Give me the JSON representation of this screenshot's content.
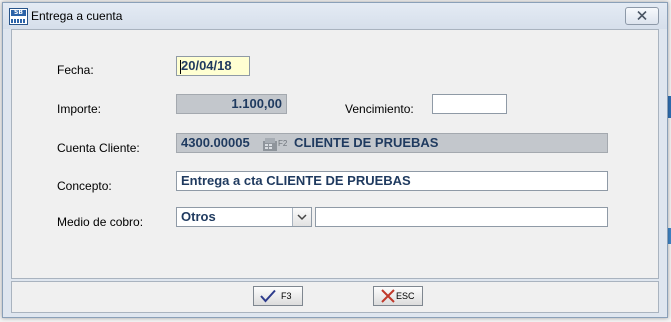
{
  "window": {
    "title": "Entrega a cuenta",
    "icon": "sb-app-icon"
  },
  "form": {
    "fecha": {
      "label": "Fecha:",
      "value": "20/04/18"
    },
    "importe": {
      "label": "Importe:",
      "value": "1.100,00"
    },
    "vencimiento": {
      "label": "Vencimiento:",
      "value": ""
    },
    "cuenta_cliente": {
      "label": "Cuenta Cliente:",
      "code": "4300.00005",
      "lookup_key": "F2",
      "name": "CLIENTE DE PRUEBAS"
    },
    "concepto": {
      "label": "Concepto:",
      "value": "Entrega a cta CLIENTE DE PRUEBAS"
    },
    "medio_cobro": {
      "label": "Medio de cobro:",
      "selected": "Otros",
      "extra": ""
    }
  },
  "footer": {
    "accept_label": "F3",
    "cancel_label": "ESC"
  },
  "colors": {
    "accent_blue": "#2f6fb3",
    "fecha_bg": "#ffffd2",
    "readonly_bg": "#c3c7cc"
  }
}
